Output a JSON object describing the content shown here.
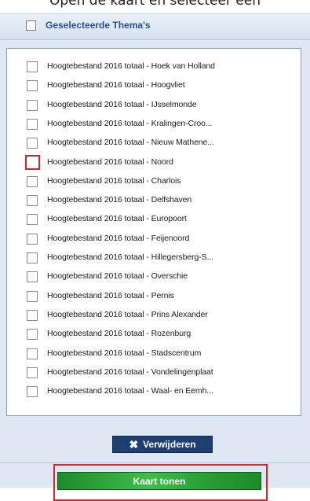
{
  "caption": "Open de kaart en selecteer een",
  "panel": {
    "header_title": "Geselecteerde Thema's",
    "items": [
      {
        "label": "Hoogtebestand 2016 totaal - Hoek van Holland",
        "highlighted": false
      },
      {
        "label": "Hoogtebestand 2016 totaal - Hoogvliet",
        "highlighted": false
      },
      {
        "label": "Hoogtebestand 2016 totaal - IJsselmonde",
        "highlighted": false
      },
      {
        "label": "Hoogtebestand 2016 totaal - Kralingen-Croo...",
        "highlighted": false
      },
      {
        "label": "Hoogtebestand 2016 totaal - Nieuw Mathene...",
        "highlighted": false
      },
      {
        "label": "Hoogtebestand 2016 totaal - Noord",
        "highlighted": true
      },
      {
        "label": "Hoogtebestand 2016 totaal - Charlois",
        "highlighted": false
      },
      {
        "label": "Hoogtebestand 2016 totaal - Delfshaven",
        "highlighted": false
      },
      {
        "label": "Hoogtebestand 2016 totaal - Europoort",
        "highlighted": false
      },
      {
        "label": "Hoogtebestand 2016 totaal - Feijenoord",
        "highlighted": false
      },
      {
        "label": "Hoogtebestand 2016 totaal - Hillegersberg-S...",
        "highlighted": false
      },
      {
        "label": "Hoogtebestand 2016 totaal - Overschie",
        "highlighted": false
      },
      {
        "label": "Hoogtebestand 2016 totaal - Pernis",
        "highlighted": false
      },
      {
        "label": "Hoogtebestand 2016 totaal - Prins Alexander",
        "highlighted": false
      },
      {
        "label": "Hoogtebestand 2016 totaal - Rozenburg",
        "highlighted": false
      },
      {
        "label": "Hoogtebestand 2016 totaal - Stadscentrum",
        "highlighted": false
      },
      {
        "label": "Hoogtebestand 2016 totaal - Vondelingenplaat",
        "highlighted": false
      },
      {
        "label": "Hoogtebestand 2016 totaal - Waal- en Eemh...",
        "highlighted": false
      }
    ],
    "delete_label": "Verwijderen",
    "show_map_label": "Kaart tonen"
  },
  "colors": {
    "header_text": "#2a4f86",
    "delete_button": "#1f3f73",
    "show_button": "#2aa136",
    "highlight": "#d9232a"
  }
}
